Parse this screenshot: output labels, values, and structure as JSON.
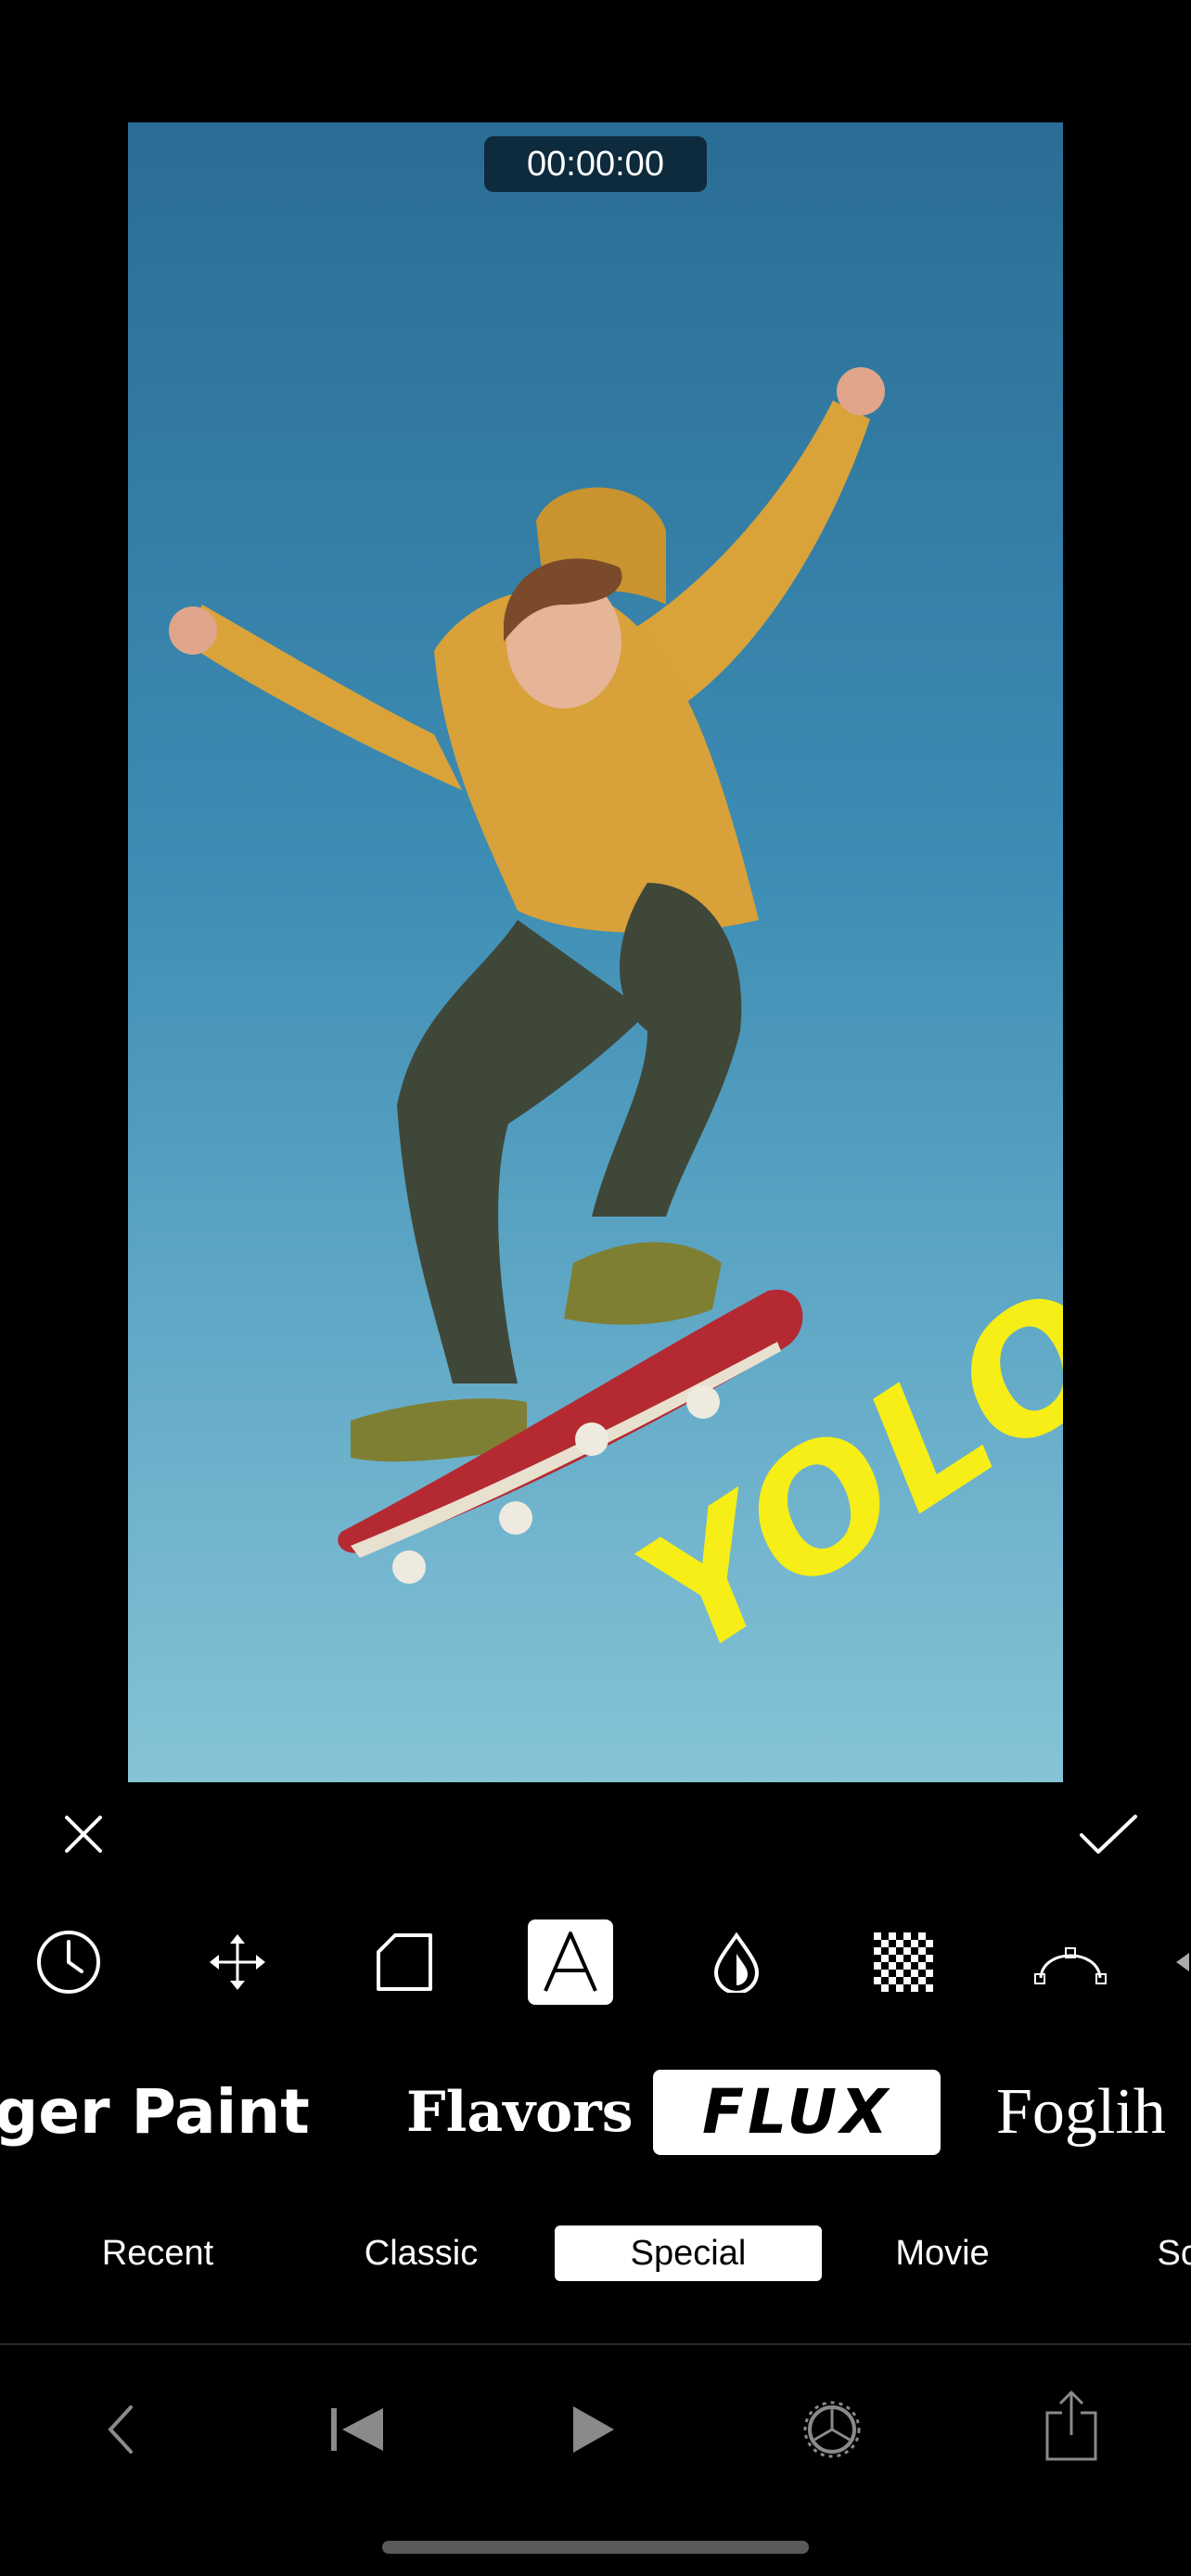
{
  "preview": {
    "timecode": "00:00:00",
    "overlay_text": "YOLO",
    "overlay_color": "#f6ee16"
  },
  "actions": {
    "close_icon": "close-icon",
    "confirm_icon": "checkmark-icon"
  },
  "tools": [
    {
      "name": "clock",
      "icon": "clock-icon",
      "active": false
    },
    {
      "name": "move",
      "icon": "move-arrows-icon",
      "active": false
    },
    {
      "name": "shape",
      "icon": "tag-shape-icon",
      "active": false
    },
    {
      "name": "text",
      "icon": "text-a-icon",
      "active": true
    },
    {
      "name": "color",
      "icon": "drop-icon",
      "active": false
    },
    {
      "name": "opacity",
      "icon": "checkerboard-icon",
      "active": false
    },
    {
      "name": "curve",
      "icon": "curve-icon",
      "active": false
    }
  ],
  "fonts": {
    "items": [
      "ger Paint",
      "Flavors",
      "FLUX",
      "Foglih"
    ],
    "selected": "FLUX"
  },
  "categories": {
    "items": [
      "Recent",
      "Classic",
      "Special",
      "Movie",
      "Scr"
    ],
    "selected": "Special"
  },
  "bottom_bar": [
    "back-icon",
    "skip-to-start-icon",
    "play-icon",
    "settings-gear-icon",
    "share-icon"
  ]
}
